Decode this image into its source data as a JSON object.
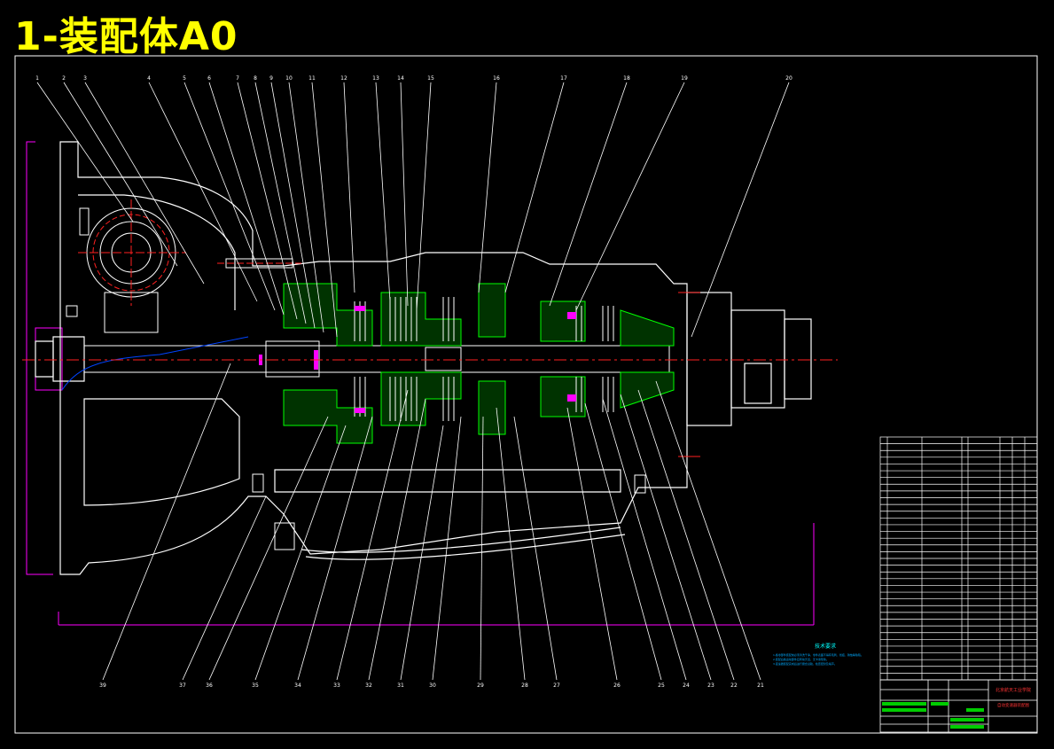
{
  "title": "1-装配体A0",
  "technical_requirements": {
    "heading": "技术要求",
    "lines": [
      "1.各零部件装配前必须清洗干净，零件表面不得有毛刺、划痕、锈蚀等缺陷。",
      "2.装配后各运动部件应转动灵活，无卡滞现象。",
      "3.变速器装配完成后进行磨合试验，检查密封及噪声。"
    ]
  },
  "title_block": {
    "company": "北京航天工业学院",
    "drawing_name": "自动变速器装配图"
  },
  "balloons_top": [
    "1",
    "2",
    "3",
    "4",
    "5",
    "6",
    "7",
    "8",
    "9",
    "10",
    "11",
    "12",
    "13",
    "14",
    "15",
    "16",
    "17",
    "18",
    "19",
    "20"
  ],
  "balloons_bottom": [
    "39",
    "37",
    "36",
    "35",
    "34",
    "33",
    "32",
    "31",
    "30",
    "29",
    "28",
    "27",
    "26",
    "25",
    "24",
    "23",
    "22",
    "21"
  ],
  "colors": {
    "background": "#000000",
    "outline": "#ffffff",
    "centerline": "#ff2020",
    "section": "#00ff00",
    "dimension": "#ff00ff",
    "title": "#ffff00",
    "note_heading": "#00ffff"
  }
}
